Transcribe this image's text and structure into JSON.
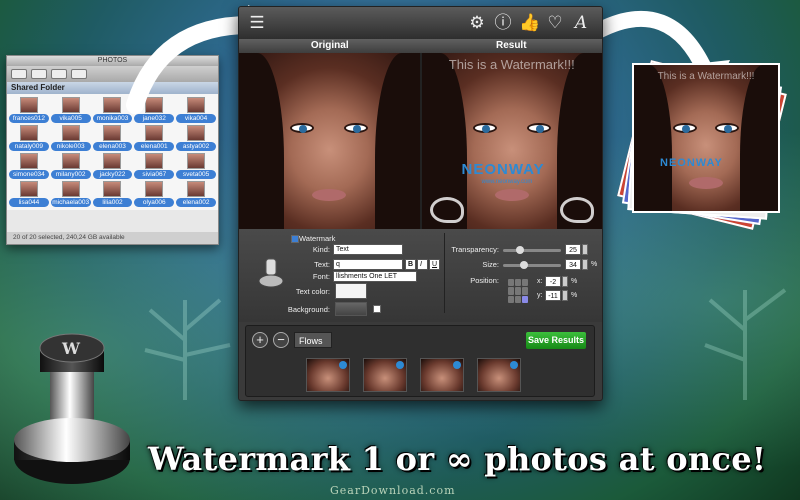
{
  "tagline": "Watermark 1 or ∞ photos at once!",
  "credit": "GearDownload.com",
  "finder": {
    "title": "PHOTOS",
    "section": "Shared Folder",
    "status": "20 of 20 selected, 240,24 GB available",
    "items": [
      "frances012",
      "vika005",
      "monika003",
      "jane032",
      "vika004",
      "nataly009",
      "nikole003",
      "elena003",
      "elena001",
      "astya002",
      "simone034",
      "milany002",
      "jacky022",
      "sivia067",
      "sveta005",
      "lisa044",
      "michaela003",
      "lilia002",
      "olya006",
      "elena002"
    ]
  },
  "app": {
    "tabs": {
      "original": "Original",
      "result": "Result"
    },
    "watermark_text": "This is a Watermark!!!",
    "brand": "NEONWAY",
    "brand_url": "www.neonway.com",
    "controls": {
      "watermark_label": "Watermark",
      "kind_label": "Kind:",
      "kind_value": "Text",
      "text_label": "Text:",
      "text_value": "q",
      "bold": "B",
      "italic": "I",
      "underline": "U",
      "font_label": "Font:",
      "font_value": "llishments One LET",
      "textcolor_label": "Text color:",
      "background_label": "Background:",
      "transparency_label": "Transparency:",
      "transparency_value": "25",
      "transparency_level": 0.25,
      "size_label": "Size:",
      "size_value": "34",
      "size_unit": "%",
      "size_level": 0.34,
      "position_label": "Position:",
      "x_label": "x:",
      "x_value": "-2",
      "x_unit": "%",
      "y_label": "y:",
      "y_value": "-11",
      "y_unit": "%"
    },
    "flows": {
      "add": "+",
      "remove": "−",
      "select": "Flows",
      "save_button": "Save Results"
    }
  },
  "stack_text": "This is a Watermark!!!",
  "colors": {
    "save_green": "#2aa82a",
    "selection_blue": "#3d7fd4",
    "brand_blue": "#2d8ad4"
  }
}
